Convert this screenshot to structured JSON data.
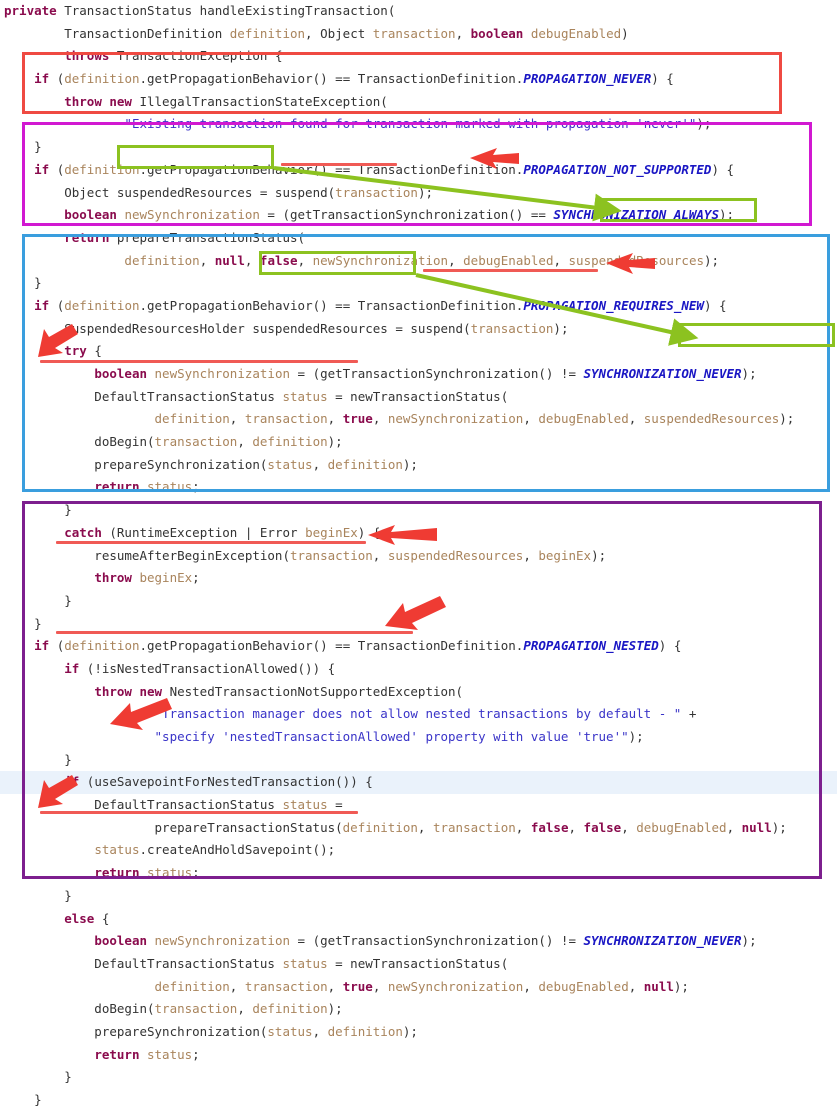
{
  "editor": {
    "language": "java",
    "current_line_highlight_color": "#eaf2fb",
    "background": "#ffffff"
  },
  "theme": {
    "keyword": "#8a0b4d",
    "type": "#333333",
    "identifier": "#a9845c",
    "string": "#3a34c8",
    "constant": "#1a16c4",
    "punctuation": "#3f3f3f"
  },
  "annotations": {
    "box_red": "#ef4a42",
    "box_magenta": "#d118d1",
    "box_blue": "#3a9ede",
    "box_purple": "#7d1f8e",
    "box_green": "#8cc220",
    "arrow_red": "#ef3b33",
    "arrow_green": "#8cc220",
    "underline_red": "#f05a55"
  },
  "code": {
    "lines": [
      [
        {
          "t": "private",
          "c": "kw"
        },
        {
          "t": " ",
          "c": "pn"
        },
        {
          "t": "TransactionStatus handleExistingTransaction(",
          "c": "typ"
        }
      ],
      [
        {
          "t": "        TransactionDefinition ",
          "c": "typ"
        },
        {
          "t": "definition",
          "c": "id"
        },
        {
          "t": ", Object ",
          "c": "typ"
        },
        {
          "t": "transaction",
          "c": "id"
        },
        {
          "t": ", ",
          "c": "typ"
        },
        {
          "t": "boolean",
          "c": "kw"
        },
        {
          "t": " ",
          "c": "typ"
        },
        {
          "t": "debugEnabled",
          "c": "id"
        },
        {
          "t": ")",
          "c": "typ"
        }
      ],
      [
        {
          "t": "        ",
          "c": "typ"
        },
        {
          "t": "throws",
          "c": "kw"
        },
        {
          "t": " TransactionException {",
          "c": "typ"
        }
      ],
      [
        {
          "t": "    ",
          "c": "typ"
        },
        {
          "t": "if",
          "c": "kw"
        },
        {
          "t": " (",
          "c": "typ"
        },
        {
          "t": "definition",
          "c": "id"
        },
        {
          "t": ".getPropagationBehavior() == TransactionDefinition.",
          "c": "typ"
        },
        {
          "t": "PROPAGATION_NEVER",
          "c": "cst"
        },
        {
          "t": ") {",
          "c": "typ"
        }
      ],
      [
        {
          "t": "        ",
          "c": "typ"
        },
        {
          "t": "throw new",
          "c": "kw"
        },
        {
          "t": " IllegalTransactionStateException(",
          "c": "typ"
        }
      ],
      [
        {
          "t": "                ",
          "c": "typ"
        },
        {
          "t": "\"Existing transaction found for transaction marked with propagation 'never'\"",
          "c": "str"
        },
        {
          "t": ");",
          "c": "typ"
        }
      ],
      [
        {
          "t": "    }",
          "c": "typ"
        }
      ],
      [
        {
          "t": "    ",
          "c": "typ"
        },
        {
          "t": "if",
          "c": "kw"
        },
        {
          "t": " (",
          "c": "typ"
        },
        {
          "t": "definition",
          "c": "id"
        },
        {
          "t": ".getPropagationBehavior() == TransactionDefinition.",
          "c": "typ"
        },
        {
          "t": "PROPAGATION_NOT_SUPPORTED",
          "c": "cst"
        },
        {
          "t": ") {",
          "c": "typ"
        }
      ],
      [
        {
          "t": "        Object ",
          "c": "typ"
        },
        {
          "t": "suspendedResources",
          "c": "typ"
        },
        {
          "t": " = suspend(",
          "c": "typ"
        },
        {
          "t": "transaction",
          "c": "id"
        },
        {
          "t": ");",
          "c": "typ"
        }
      ],
      [
        {
          "t": "        ",
          "c": "typ"
        },
        {
          "t": "boolean",
          "c": "kw"
        },
        {
          "t": " ",
          "c": "typ"
        },
        {
          "t": "newSynchronization",
          "c": "id"
        },
        {
          "t": " = (getTransactionSynchronization() == ",
          "c": "typ"
        },
        {
          "t": "SYNCHRONIZATION_ALWAYS",
          "c": "cst"
        },
        {
          "t": ");",
          "c": "typ"
        }
      ],
      [
        {
          "t": "        ",
          "c": "typ"
        },
        {
          "t": "return",
          "c": "kw"
        },
        {
          "t": " prepareTransactionStatus(",
          "c": "typ"
        }
      ],
      [
        {
          "t": "                ",
          "c": "typ"
        },
        {
          "t": "definition",
          "c": "id"
        },
        {
          "t": ", ",
          "c": "typ"
        },
        {
          "t": "null",
          "c": "kw"
        },
        {
          "t": ", ",
          "c": "typ"
        },
        {
          "t": "false",
          "c": "kw"
        },
        {
          "t": ", ",
          "c": "typ"
        },
        {
          "t": "newSynchronization",
          "c": "id"
        },
        {
          "t": ", ",
          "c": "typ"
        },
        {
          "t": "debugEnabled",
          "c": "id"
        },
        {
          "t": ", ",
          "c": "typ"
        },
        {
          "t": "suspendedResources",
          "c": "id"
        },
        {
          "t": ");",
          "c": "typ"
        }
      ],
      [
        {
          "t": "    }",
          "c": "typ"
        }
      ],
      [
        {
          "t": "    ",
          "c": "typ"
        },
        {
          "t": "if",
          "c": "kw"
        },
        {
          "t": " (",
          "c": "typ"
        },
        {
          "t": "definition",
          "c": "id"
        },
        {
          "t": ".getPropagationBehavior() == TransactionDefinition.",
          "c": "typ"
        },
        {
          "t": "PROPAGATION_REQUIRES_NEW",
          "c": "cst"
        },
        {
          "t": ") {",
          "c": "typ"
        }
      ],
      [
        {
          "t": "        SuspendedResourcesHolder ",
          "c": "typ"
        },
        {
          "t": "suspendedResources",
          "c": "typ"
        },
        {
          "t": " = suspend(",
          "c": "typ"
        },
        {
          "t": "transaction",
          "c": "id"
        },
        {
          "t": ");",
          "c": "typ"
        }
      ],
      [
        {
          "t": "        ",
          "c": "typ"
        },
        {
          "t": "try",
          "c": "kw"
        },
        {
          "t": " {",
          "c": "typ"
        }
      ],
      [
        {
          "t": "            ",
          "c": "typ"
        },
        {
          "t": "boolean",
          "c": "kw"
        },
        {
          "t": " ",
          "c": "typ"
        },
        {
          "t": "newSynchronization",
          "c": "id"
        },
        {
          "t": " = (getTransactionSynchronization() != ",
          "c": "typ"
        },
        {
          "t": "SYNCHRONIZATION_NEVER",
          "c": "cst"
        },
        {
          "t": ");",
          "c": "typ"
        }
      ],
      [
        {
          "t": "            DefaultTransactionStatus ",
          "c": "typ"
        },
        {
          "t": "status",
          "c": "id"
        },
        {
          "t": " = newTransactionStatus(",
          "c": "typ"
        }
      ],
      [
        {
          "t": "                    ",
          "c": "typ"
        },
        {
          "t": "definition",
          "c": "id"
        },
        {
          "t": ", ",
          "c": "typ"
        },
        {
          "t": "transaction",
          "c": "id"
        },
        {
          "t": ", ",
          "c": "typ"
        },
        {
          "t": "true",
          "c": "kw"
        },
        {
          "t": ", ",
          "c": "typ"
        },
        {
          "t": "newSynchronization",
          "c": "id"
        },
        {
          "t": ", ",
          "c": "typ"
        },
        {
          "t": "debugEnabled",
          "c": "id"
        },
        {
          "t": ", ",
          "c": "typ"
        },
        {
          "t": "suspendedResources",
          "c": "id"
        },
        {
          "t": ");",
          "c": "typ"
        }
      ],
      [
        {
          "t": "            doBegin(",
          "c": "typ"
        },
        {
          "t": "transaction",
          "c": "id"
        },
        {
          "t": ", ",
          "c": "typ"
        },
        {
          "t": "definition",
          "c": "id"
        },
        {
          "t": ");",
          "c": "typ"
        }
      ],
      [
        {
          "t": "            prepareSynchronization(",
          "c": "typ"
        },
        {
          "t": "status",
          "c": "id"
        },
        {
          "t": ", ",
          "c": "typ"
        },
        {
          "t": "definition",
          "c": "id"
        },
        {
          "t": ");",
          "c": "typ"
        }
      ],
      [
        {
          "t": "            ",
          "c": "typ"
        },
        {
          "t": "return",
          "c": "kw"
        },
        {
          "t": " ",
          "c": "typ"
        },
        {
          "t": "status",
          "c": "id"
        },
        {
          "t": ";",
          "c": "typ"
        }
      ],
      [
        {
          "t": "        }",
          "c": "typ"
        }
      ],
      [
        {
          "t": "        ",
          "c": "typ"
        },
        {
          "t": "catch",
          "c": "kw"
        },
        {
          "t": " (RuntimeException | Error ",
          "c": "typ"
        },
        {
          "t": "beginEx",
          "c": "id"
        },
        {
          "t": ") {",
          "c": "typ"
        }
      ],
      [
        {
          "t": "            resumeAfterBeginException(",
          "c": "typ"
        },
        {
          "t": "transaction",
          "c": "id"
        },
        {
          "t": ", ",
          "c": "typ"
        },
        {
          "t": "suspendedResources",
          "c": "id"
        },
        {
          "t": ", ",
          "c": "typ"
        },
        {
          "t": "beginEx",
          "c": "id"
        },
        {
          "t": ");",
          "c": "typ"
        }
      ],
      [
        {
          "t": "            ",
          "c": "typ"
        },
        {
          "t": "throw",
          "c": "kw"
        },
        {
          "t": " ",
          "c": "typ"
        },
        {
          "t": "beginEx",
          "c": "id"
        },
        {
          "t": ";",
          "c": "typ"
        }
      ],
      [
        {
          "t": "        }",
          "c": "typ"
        }
      ],
      [
        {
          "t": "    }",
          "c": "typ"
        }
      ],
      [
        {
          "t": "    ",
          "c": "typ"
        },
        {
          "t": "if",
          "c": "kw"
        },
        {
          "t": " (",
          "c": "typ"
        },
        {
          "t": "definition",
          "c": "id"
        },
        {
          "t": ".getPropagationBehavior() == TransactionDefinition.",
          "c": "typ"
        },
        {
          "t": "PROPAGATION_NESTED",
          "c": "cst"
        },
        {
          "t": ") {",
          "c": "typ"
        }
      ],
      [
        {
          "t": "        ",
          "c": "typ"
        },
        {
          "t": "if",
          "c": "kw"
        },
        {
          "t": " (!isNestedTransactionAllowed()) {",
          "c": "typ"
        }
      ],
      [
        {
          "t": "            ",
          "c": "typ"
        },
        {
          "t": "throw new",
          "c": "kw"
        },
        {
          "t": " NestedTransactionNotSupportedException(",
          "c": "typ"
        }
      ],
      [
        {
          "t": "                    ",
          "c": "typ"
        },
        {
          "t": "\"Transaction manager does not allow nested transactions by default - \"",
          "c": "str"
        },
        {
          "t": " +",
          "c": "typ"
        }
      ],
      [
        {
          "t": "                    ",
          "c": "typ"
        },
        {
          "t": "\"specify 'nestedTransactionAllowed' property with value 'true'\"",
          "c": "str"
        },
        {
          "t": ");",
          "c": "typ"
        }
      ],
      [
        {
          "t": "        }",
          "c": "typ"
        }
      ],
      [
        {
          "t": "        ",
          "c": "typ"
        },
        {
          "t": "if",
          "c": "kw"
        },
        {
          "t": " (useSavepointForNestedTransaction()) {",
          "c": "typ"
        }
      ],
      [
        {
          "t": "            DefaultTransactionStatus ",
          "c": "typ"
        },
        {
          "t": "status",
          "c": "id"
        },
        {
          "t": " =",
          "c": "typ"
        }
      ],
      [
        {
          "t": "                    prepareTransactionStatus(",
          "c": "typ"
        },
        {
          "t": "definition",
          "c": "id"
        },
        {
          "t": ", ",
          "c": "typ"
        },
        {
          "t": "transaction",
          "c": "id"
        },
        {
          "t": ", ",
          "c": "typ"
        },
        {
          "t": "false",
          "c": "kw"
        },
        {
          "t": ", ",
          "c": "typ"
        },
        {
          "t": "false",
          "c": "kw"
        },
        {
          "t": ", ",
          "c": "typ"
        },
        {
          "t": "debugEnabled",
          "c": "id"
        },
        {
          "t": ", ",
          "c": "typ"
        },
        {
          "t": "null",
          "c": "kw"
        },
        {
          "t": ");",
          "c": "typ"
        }
      ],
      [
        {
          "t": "            ",
          "c": "typ"
        },
        {
          "t": "status",
          "c": "id"
        },
        {
          "t": ".createAndHoldSavepoint();",
          "c": "typ"
        }
      ],
      [
        {
          "t": "            ",
          "c": "typ"
        },
        {
          "t": "return",
          "c": "kw"
        },
        {
          "t": " ",
          "c": "typ"
        },
        {
          "t": "status",
          "c": "id"
        },
        {
          "t": ";",
          "c": "typ"
        }
      ],
      [
        {
          "t": "        }",
          "c": "typ"
        }
      ],
      [
        {
          "t": "        ",
          "c": "typ"
        },
        {
          "t": "else",
          "c": "kw"
        },
        {
          "t": " {",
          "c": "typ"
        }
      ],
      [
        {
          "t": "            ",
          "c": "typ"
        },
        {
          "t": "boolean",
          "c": "kw"
        },
        {
          "t": " ",
          "c": "typ"
        },
        {
          "t": "newSynchronization",
          "c": "id"
        },
        {
          "t": " = (getTransactionSynchronization() != ",
          "c": "typ"
        },
        {
          "t": "SYNCHRONIZATION_NEVER",
          "c": "cst"
        },
        {
          "t": ");",
          "c": "typ"
        }
      ],
      [
        {
          "t": "            DefaultTransactionStatus ",
          "c": "typ"
        },
        {
          "t": "status",
          "c": "id"
        },
        {
          "t": " = newTransactionStatus(",
          "c": "typ"
        }
      ],
      [
        {
          "t": "                    ",
          "c": "typ"
        },
        {
          "t": "definition",
          "c": "id"
        },
        {
          "t": ", ",
          "c": "typ"
        },
        {
          "t": "transaction",
          "c": "id"
        },
        {
          "t": ", ",
          "c": "typ"
        },
        {
          "t": "true",
          "c": "kw"
        },
        {
          "t": ", ",
          "c": "typ"
        },
        {
          "t": "newSynchronization",
          "c": "id"
        },
        {
          "t": ", ",
          "c": "typ"
        },
        {
          "t": "debugEnabled",
          "c": "id"
        },
        {
          "t": ", ",
          "c": "typ"
        },
        {
          "t": "null",
          "c": "kw"
        },
        {
          "t": ");",
          "c": "typ"
        }
      ],
      [
        {
          "t": "            doBegin(",
          "c": "typ"
        },
        {
          "t": "transaction",
          "c": "id"
        },
        {
          "t": ", ",
          "c": "typ"
        },
        {
          "t": "definition",
          "c": "id"
        },
        {
          "t": ");",
          "c": "typ"
        }
      ],
      [
        {
          "t": "            prepareSynchronization(",
          "c": "typ"
        },
        {
          "t": "status",
          "c": "id"
        },
        {
          "t": ", ",
          "c": "typ"
        },
        {
          "t": "definition",
          "c": "id"
        },
        {
          "t": ");",
          "c": "typ"
        }
      ],
      [
        {
          "t": "            ",
          "c": "typ"
        },
        {
          "t": "return",
          "c": "kw"
        },
        {
          "t": " ",
          "c": "typ"
        },
        {
          "t": "status",
          "c": "id"
        },
        {
          "t": ";",
          "c": "typ"
        }
      ],
      [
        {
          "t": "        }",
          "c": "typ"
        }
      ],
      [
        {
          "t": "    }",
          "c": "typ"
        }
      ]
    ],
    "highlighted_line_index": 34
  }
}
